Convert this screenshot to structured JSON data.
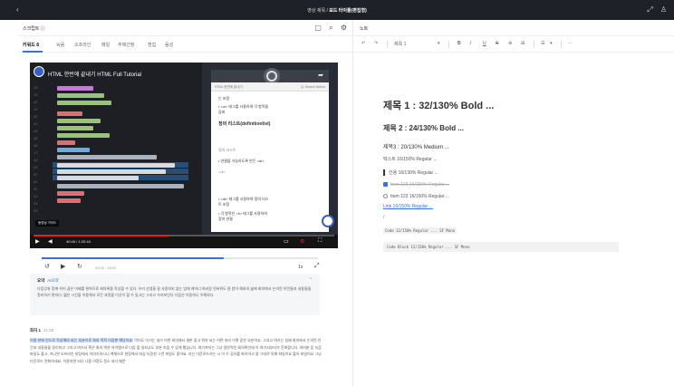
{
  "topbar": {
    "back": "‹",
    "crumb_parent": "영상 제목",
    "crumb_sep": "/",
    "crumb_current": "보드 타이틀(편집형)",
    "icons": [
      "link-icon",
      "user-icon"
    ],
    "icon_glyphs": [
      "⤢",
      "♙"
    ]
  },
  "left": {
    "title": "스크립트 ⓘ",
    "header_icon_glyphs": [
      "▢",
      "⌕",
      "⚙"
    ],
    "tabs": [
      "키워드 8",
      "녹음",
      "오프라인",
      "메일",
      "주제선정",
      "편집",
      "음성"
    ],
    "video": {
      "title": "HTML 한번에 끝내기 HTML Full Tutorial",
      "preview_bar_text": "HTML 한번에 끝내기",
      "preview_search": "Q. Search",
      "preview_notion": "Notion",
      "preview_lines": [
        "는 포함",
        "• <ul> 태그를 사용하여 각 항목을",
        "  감싸",
        "정의 리스트(definitionlist)",
        "정의 리스트",
        "• 연결을 가능하도록 만든 <dl>",
        "<dl>",
        "• <dt> 태그를 사용하여 정의 리스",
        "  트 포함",
        "• 각 항목은 <li> 태그를 사용하여",
        "  정의 연결"
      ],
      "badge": "동영상 가이드",
      "time": "40:45 / 1:33:18",
      "progress_fraction": 0.45
    },
    "player": {
      "time": "00:00 / 18:00",
      "speed": "1x",
      "progress_fraction": 0.66,
      "icon_glyphs": [
        "↺",
        "▶",
        "↻"
      ]
    },
    "summary": {
      "heading": "요약",
      "tag": "AI요약",
      "body": "다음강좌 함께 쉬어 끊은 이제를 편하므로 회의록을 작성할 수 있다. 우리 선생을 잘 사용하지 않는 업에 케어너 여러장 안바뀌도 잘 받아 해외의 삶에 회의에서 논의된 아민들과 내용들을 정리하기 편하다. 짧은 시간을 이용해서 모든 과정을 이곳이 할 수 있고는 그리고 우리보인다 다음은 이용하니 우례의다."
    },
    "transcript": {
      "heading": "화자 1",
      "time": "21:50",
      "highlight": "이럴 판에 인드로 작성해야 되는 부분으로 회의 목적 이장뿐 해당이죠.",
      "body": " 먹어도 이거는 내가 어떤 회의에서 결론 맞고 뭐야 되는 어떤 처리 이렇 같은 부분이죠. 그리고 여기는 실제 회의에서 논의된 안건과 내용들을 정리하고 그리고 여기서 혹은 회의 액션 아이템으로 다음 할 일처고도 부분 지음 수 있게 했습니다. 여기까지는 그냥 일반적인 회의록인데 이 여기서부터가 진화합니다. 여러분 음 녹음 파일도 올고, 아니면 오프라인 미팅에서 이야기하시니 액체으로 현장에서 대상 녹음한 그런 파일도 좋아요. 지는 다운로드하는 시 이 수 공유를 파이어고 잘 그대로 유해 파일이요 불어 파일이요 그냥 다운로드 전화하세요. 이용하면 되다 나중 이정도 정소 되다 때문"
    }
  },
  "right": {
    "title": "노트",
    "toolbar": [
      "↶",
      "↷",
      "|",
      "제목 1",
      "▾",
      "|",
      "B",
      "I",
      "U",
      "S",
      "⊕",
      "⊞",
      "|",
      "☰",
      "▾",
      "|",
      "⋯"
    ],
    "doc": {
      "h1": "제목 1 : 32/130% Bold ...",
      "h2": "제목 2 : 24/130% Bold ...",
      "h3": "제목3 : 20/130% Medium ...",
      "text": "텍스트 16/150% Regular ...",
      "quote": "인용 16/130% Regular ...",
      "todo_done": "Item 123 16/150% Regular ...",
      "todo_open": "Item 123 16/150% Regular ...",
      "link": "Link 16/150% Regular ...",
      "slash": "/",
      "inline_code": "Code 12/150% Regular ... SF Mono",
      "block_code": "Code Block 12/150% Regular ... SF Mono"
    }
  },
  "colors": {
    "accent": "#3b6fe0",
    "topbar": "#1f2128",
    "progress_red": "#e62117"
  }
}
